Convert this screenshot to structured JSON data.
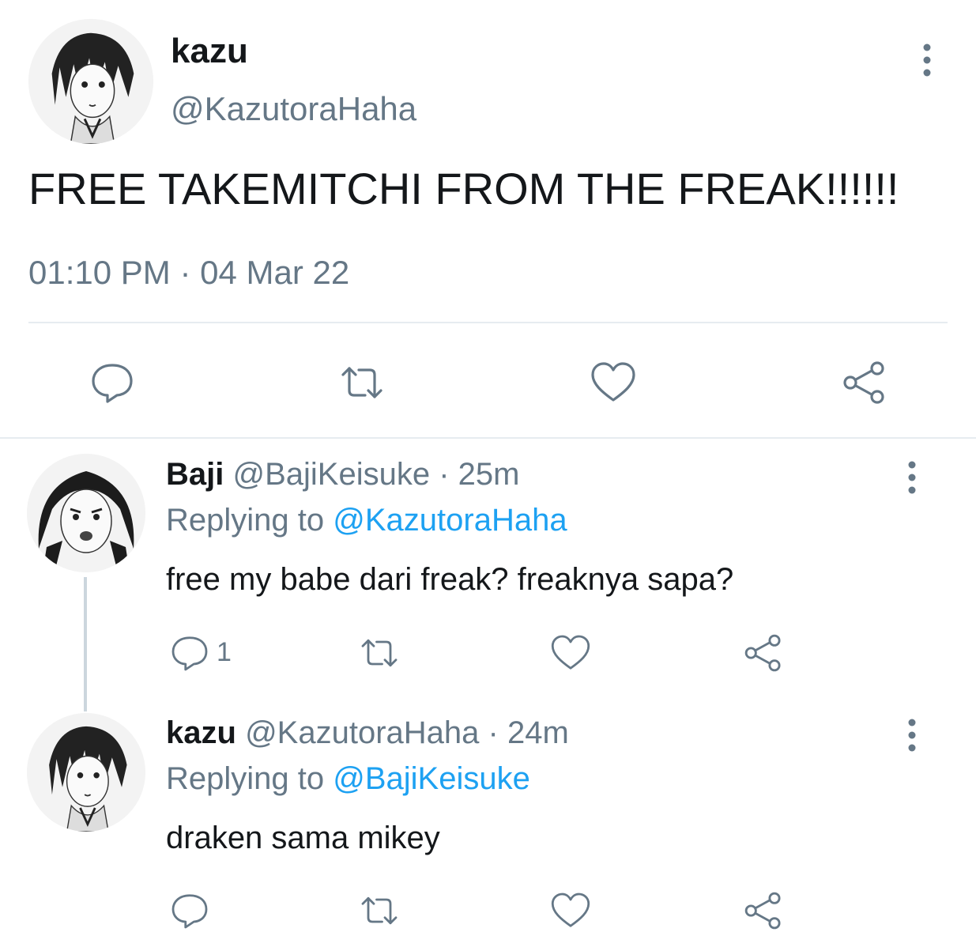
{
  "main_tweet": {
    "name": "kazu",
    "handle": "@KazutoraHaha",
    "text": "FREE TAKEMITCHI FROM THE FREAK!!!!!!",
    "time": "01:10 PM",
    "separator": "·",
    "date": "04 Mar 22"
  },
  "replies": [
    {
      "name": "Baji",
      "handle": "@BajiKeisuke",
      "dot": "·",
      "age": "25m",
      "replying_prefix": "Replying to",
      "replying_to": "@KazutoraHaha",
      "text": "free my babe dari freak? freaknya sapa?",
      "reply_count": "1"
    },
    {
      "name": "kazu",
      "handle": "@KazutoraHaha",
      "dot": "·",
      "age": "24m",
      "replying_prefix": "Replying to",
      "replying_to": "@BajiKeisuke",
      "text": "draken sama mikey",
      "reply_count": ""
    }
  ],
  "colors": {
    "text": "#14171a",
    "muted": "#657786",
    "link": "#1da1f2",
    "divider": "#e6ecf0"
  },
  "icons": [
    "reply-icon",
    "retweet-icon",
    "like-icon",
    "share-icon",
    "more-options-icon"
  ]
}
